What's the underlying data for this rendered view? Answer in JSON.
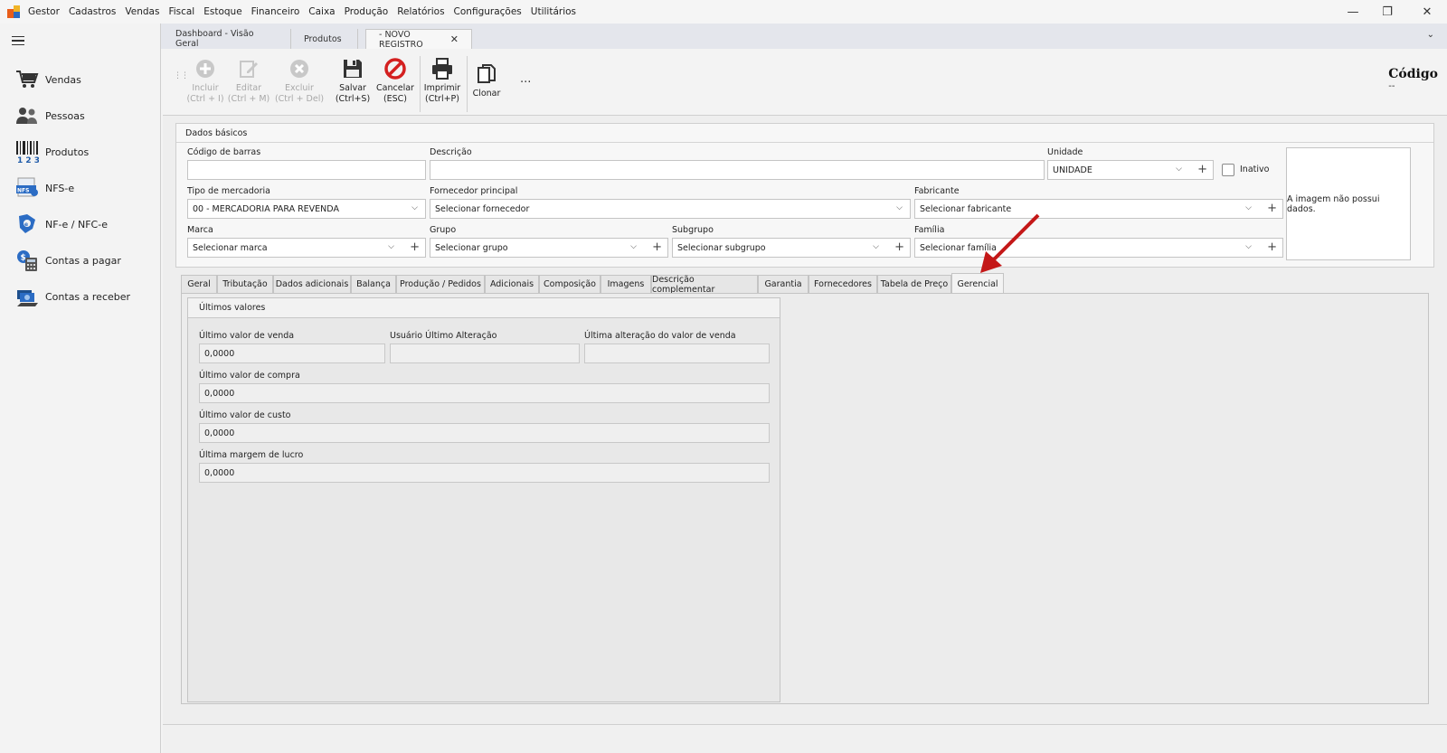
{
  "menu": [
    "Gestor",
    "Cadastros",
    "Vendas",
    "Fiscal",
    "Estoque",
    "Financeiro",
    "Caixa",
    "Produção",
    "Relatórios",
    "Configurações",
    "Utilitários"
  ],
  "window": {
    "minimize": "—",
    "restore": "❐",
    "close": "✕"
  },
  "sidebar": {
    "items": [
      {
        "label": "Vendas",
        "icon": "cart-icon"
      },
      {
        "label": "Pessoas",
        "icon": "people-icon"
      },
      {
        "label": "Produtos",
        "icon": "barcode-icon"
      },
      {
        "label": "NFS-e",
        "icon": "nfse-icon"
      },
      {
        "label": "NF-e / NFC-e",
        "icon": "nfe-icon"
      },
      {
        "label": "Contas a pagar",
        "icon": "calculator-icon"
      },
      {
        "label": "Contas a receber",
        "icon": "money-icon"
      }
    ]
  },
  "doc_tabs": [
    {
      "label": "Dashboard - Visão Geral"
    },
    {
      "label": "Produtos"
    },
    {
      "label": "- NOVO REGISTRO",
      "active": true
    }
  ],
  "toolbar": {
    "incluir": {
      "line1": "Incluir",
      "line2": "(Ctrl + I)"
    },
    "editar": {
      "line1": "Editar",
      "line2": "(Ctrl + M)"
    },
    "excluir": {
      "line1": "Excluir",
      "line2": "(Ctrl + Del)"
    },
    "salvar": {
      "line1": "Salvar",
      "line2": "(Ctrl+S)"
    },
    "cancelar": {
      "line1": "Cancelar",
      "line2": "(ESC)"
    },
    "imprimir": {
      "line1": "Imprimir",
      "line2": "(Ctrl+P)"
    },
    "clonar": {
      "line1": "Clonar"
    },
    "more": "..."
  },
  "codigo": {
    "title": "Código",
    "value": "--"
  },
  "dados_basicos": {
    "title": "Dados básicos",
    "codigo_barras": {
      "label": "Código de barras",
      "value": ""
    },
    "descricao": {
      "label": "Descrição",
      "value": ""
    },
    "unidade": {
      "label": "Unidade",
      "value": "UNIDADE"
    },
    "inativo": {
      "label": "Inativo"
    },
    "tipo_mercadoria": {
      "label": "Tipo de mercadoria",
      "value": "00 - MERCADORIA PARA REVENDA"
    },
    "fornecedor": {
      "label": "Fornecedor principal",
      "value": "Selecionar fornecedor"
    },
    "fabricante": {
      "label": "Fabricante",
      "value": "Selecionar fabricante"
    },
    "marca": {
      "label": "Marca",
      "value": "Selecionar marca"
    },
    "grupo": {
      "label": "Grupo",
      "value": "Selecionar grupo"
    },
    "subgrupo": {
      "label": "Subgrupo",
      "value": "Selecionar subgrupo"
    },
    "familia": {
      "label": "Família",
      "value": "Selecionar família"
    },
    "imagem": "A imagem não possui dados."
  },
  "tabs": [
    "Geral",
    "Tributação",
    "Dados adicionais",
    "Balança",
    "Produção / Pedidos",
    "Adicionais",
    "Composição",
    "Imagens",
    "Descrição complementar",
    "Garantia",
    "Fornecedores",
    "Tabela de Preço",
    "Gerencial"
  ],
  "active_tab": "Gerencial",
  "ultimos": {
    "title": "Últimos valores",
    "venda": {
      "label": "Último valor de venda",
      "value": "0,0000"
    },
    "usuario": {
      "label": "Usuário Último Alteração",
      "value": ""
    },
    "alteracao": {
      "label": "Última alteração do valor de venda",
      "value": ""
    },
    "compra": {
      "label": "Último valor de compra",
      "value": "0,0000"
    },
    "custo": {
      "label": "Último valor de custo",
      "value": "0,0000"
    },
    "margem": {
      "label": "Última margem de lucro",
      "value": "0,0000"
    }
  },
  "colors": {
    "accent_red": "#d42020",
    "tab_bg": "#e4e6ec"
  }
}
